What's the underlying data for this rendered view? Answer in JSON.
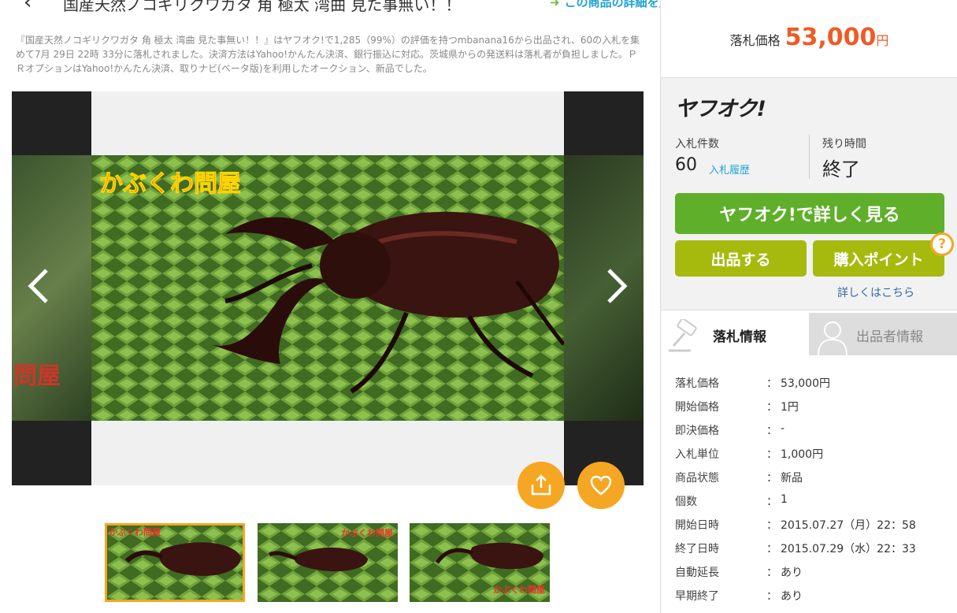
{
  "header": {
    "back_glyph": "‹",
    "title": "国産天然ノコギリクワガタ 角 極太 湾曲 見た事無い！！",
    "detail_link": "この商品の詳細を見る"
  },
  "description": "『国産天然ノコギリクワガタ 角 極太 湾曲 見た事無い！！』はヤフオク!で1,285（99%）の評価を持つmbanana16から出品され、60の入札を集めて7月 29日 22時 33分に落札されました。決済方法はYahoo!かんたん決済、銀行振込に対応。茨城県からの発送料は落札者が負担しました。ＰＲオプションはYahoo!かんたん決済、取りナビ(ベータ版)を利用したオークション、新品でした。",
  "gallery": {
    "watermark": "かぶくわ問屋",
    "left_partial": "問屋"
  },
  "thumbnails": [
    {
      "watermark": "かぶくわ問屋"
    },
    {
      "watermark": "かぶくわ問屋"
    },
    {
      "watermark": "かぶくわ問屋"
    }
  ],
  "price": {
    "label": "落札価格",
    "value": "53,000",
    "unit": "円"
  },
  "auction": {
    "logo": "ヤフオク!",
    "bids_label": "入札件数",
    "bids_value": "60",
    "bids_history": "入札履歴",
    "time_label": "残り時間",
    "time_value": "終了",
    "btn_view": "ヤフオク!で詳しく見る",
    "btn_sell": "出品する",
    "btn_points": "購入ポイント",
    "help": "?",
    "more_link": "詳しくはこちら"
  },
  "tabs": {
    "active": "落札情報",
    "inactive": "出品者情報"
  },
  "info": [
    {
      "key": "落札価格",
      "value": "53,000円"
    },
    {
      "key": "開始価格",
      "value": "1円"
    },
    {
      "key": "即決価格",
      "value": "-"
    },
    {
      "key": "入札単位",
      "value": "1,000円"
    },
    {
      "key": "商品状態",
      "value": "新品"
    },
    {
      "key": "個数",
      "value": "1"
    },
    {
      "key": "開始日時",
      "value": "2015.07.27（月）22：58"
    },
    {
      "key": "終了日時",
      "value": "2015.07.29（水）22：33"
    },
    {
      "key": "自動延長",
      "value": "あり"
    },
    {
      "key": "早期終了",
      "value": "あり"
    }
  ],
  "colon": "：",
  "colors": {
    "accent_orange": "#f5a623",
    "price_orange": "#f05a24",
    "green_button": "#5faf2a",
    "olive_button": "#a6ba0e",
    "link_blue": "#1fa4d6"
  }
}
